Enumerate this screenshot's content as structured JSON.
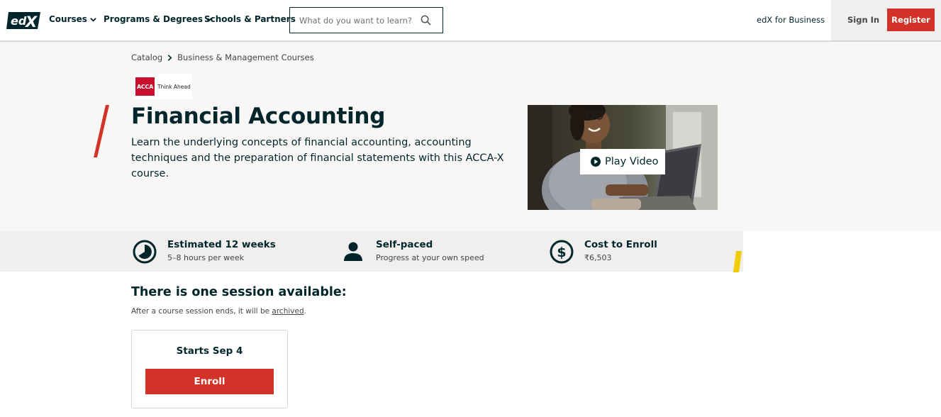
{
  "header": {
    "logo_text": "edX",
    "nav": [
      {
        "label": "Courses",
        "has_dropdown": true
      },
      {
        "label": "Programs & Degrees",
        "has_dropdown": true
      },
      {
        "label": "Schools & Partners",
        "has_dropdown": false
      }
    ],
    "search_placeholder": "What do you want to learn?",
    "business_link": "edX for Business",
    "sign_in": "Sign In",
    "register": "Register"
  },
  "breadcrumb": {
    "items": [
      "Catalog",
      "Business & Management Courses"
    ]
  },
  "partner": {
    "logo_mark": "ACCA",
    "tagline": "Think Ahead"
  },
  "course": {
    "title": "Financial Accounting",
    "description": "Learn the underlying concepts of financial accounting, accounting techniques and the preparation of financial statements with this ACCA-X course.",
    "play_video": "Play Video"
  },
  "stats": [
    {
      "icon": "clock-icon",
      "title": "Estimated 12 weeks",
      "subtitle": "5–8 hours per week"
    },
    {
      "icon": "person-icon",
      "title": "Self-paced",
      "subtitle": "Progress at your own speed"
    },
    {
      "icon": "dollar-icon",
      "title": "Cost to Enroll",
      "subtitle": "₹6,503"
    }
  ],
  "sessions": {
    "heading": "There is one session available:",
    "note_prefix": "After a course session ends, it will be ",
    "note_link": "archived",
    "note_suffix": ".",
    "cards": [
      {
        "starts": "Starts Sep 4",
        "button": "Enroll"
      }
    ]
  },
  "colors": {
    "brand_dark": "#00262b",
    "accent_red": "#d23228",
    "accent_yellow": "#f0cc00"
  }
}
